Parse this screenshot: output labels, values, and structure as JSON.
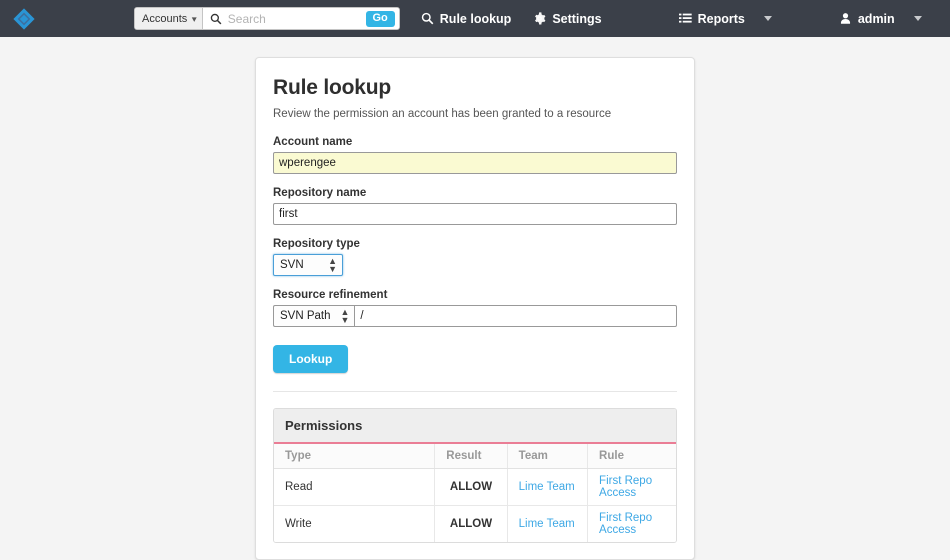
{
  "navbar": {
    "logo_icon": "diamond-logo-icon",
    "logo_color": "#2a95d5",
    "background": "#3b4049",
    "search": {
      "scope_label": "Accounts",
      "search_icon": "search-icon",
      "placeholder": "Search",
      "value": "",
      "go_label": "Go"
    },
    "links": [
      {
        "label": "Rule lookup",
        "icon": "search-icon"
      },
      {
        "label": "Settings",
        "icon": "gear-icon"
      },
      {
        "label": "Reports",
        "icon": "list-icon"
      }
    ],
    "user": {
      "label": "admin",
      "icon": "person-icon"
    }
  },
  "card": {
    "title": "Rule lookup",
    "subtitle": "Review the permission an account has been granted to a resource",
    "fields": {
      "account_name": {
        "label": "Account name",
        "value": "wperengee",
        "placeholder": ""
      },
      "repository_name": {
        "label": "Repository name",
        "value": "first",
        "placeholder": ""
      },
      "repository_type": {
        "label": "Repository type",
        "value": "SVN"
      },
      "resource_refinement": {
        "label": "Resource refinement",
        "select_value": "SVN Path",
        "path_value": "/",
        "placeholder": ""
      }
    },
    "lookup_button": "Lookup"
  },
  "permissions": {
    "title": "Permissions",
    "accent_color": "#ea7d95",
    "allow_color": "#5aa75a",
    "columns": [
      "Type",
      "Result",
      "Team",
      "Rule"
    ],
    "rows": [
      {
        "type": "Read",
        "result": "ALLOW",
        "team": "Lime Team",
        "rule": "First Repo Access"
      },
      {
        "type": "Write",
        "result": "ALLOW",
        "team": "Lime Team",
        "rule": "First Repo Access"
      }
    ]
  }
}
